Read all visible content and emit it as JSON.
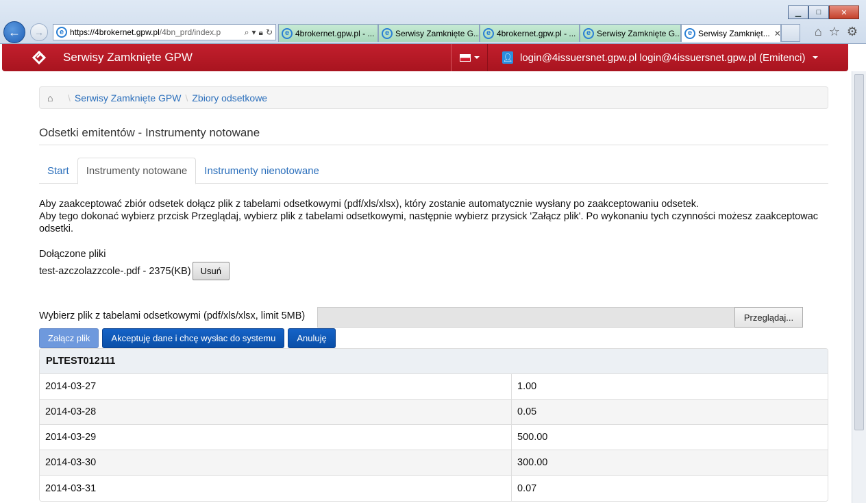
{
  "browser": {
    "url_main": "https://4brokernet.",
    "url_domain": "gpw.pl",
    "url_rest": "/4bn_prd/index.p",
    "tabs": [
      {
        "title": "4brokernet.gpw.pl - ...",
        "active": false
      },
      {
        "title": "Serwisy Zamknięte G...",
        "active": false
      },
      {
        "title": "4brokernet.gpw.pl - ...",
        "active": false
      },
      {
        "title": "Serwisy Zamknięte G...",
        "active": false
      },
      {
        "title": "Serwisy Zamknięt...",
        "active": true
      }
    ]
  },
  "navbar": {
    "brand": "Serwisy Zamknięte GPW",
    "user_label": "login@4issuersnet.gpw.pl login@4issuersnet.gpw.pl (Emitenci)"
  },
  "breadcrumb": {
    "items": [
      "Serwisy Zamknięte GPW",
      "Zbiory odsetkowe"
    ]
  },
  "page": {
    "title": "Odsetki emitentów - Instrumenty notowane",
    "tabs": [
      "Start",
      "Instrumenty notowane",
      "Instrumenty nienotowane"
    ],
    "info_line1": "Aby zaakceptować zbiór odsetek dołącz plik z tabelami odsetkowymi (pdf/xls/xlsx), który zostanie automatycznie wysłany po zaakceptowaniu odsetek.",
    "info_line2": "Aby tego dokonać wybierz przcisk Przeglądaj, wybierz plik z tabelami odsetkowymi, następnie wybierz przysick 'Załącz plik'. Po wykonaniu tych czynności możesz zaakceptowac odsetki.",
    "attached_label": "Dołączone pliki",
    "attached_file": "test-azczolazzcole-.pdf - 2375(KB)",
    "remove_label": "Usuń",
    "file_label": "Wybierz plik z tabelami odsetkowymi (pdf/xls/xlsx, limit 5MB)",
    "browse_label": "Przeglądaj...",
    "attach_label": "Załącz plik",
    "accept_label": "Akceptuję dane i chcę wysłac do systemu",
    "cancel_label": "Anuluję"
  },
  "table": {
    "header": "PLTEST012111",
    "rows": [
      {
        "date": "2014-03-27",
        "value": "1.00"
      },
      {
        "date": "2014-03-28",
        "value": "0.05"
      },
      {
        "date": "2014-03-29",
        "value": "500.00"
      },
      {
        "date": "2014-03-30",
        "value": "300.00"
      },
      {
        "date": "2014-03-31",
        "value": "0.07"
      }
    ]
  }
}
